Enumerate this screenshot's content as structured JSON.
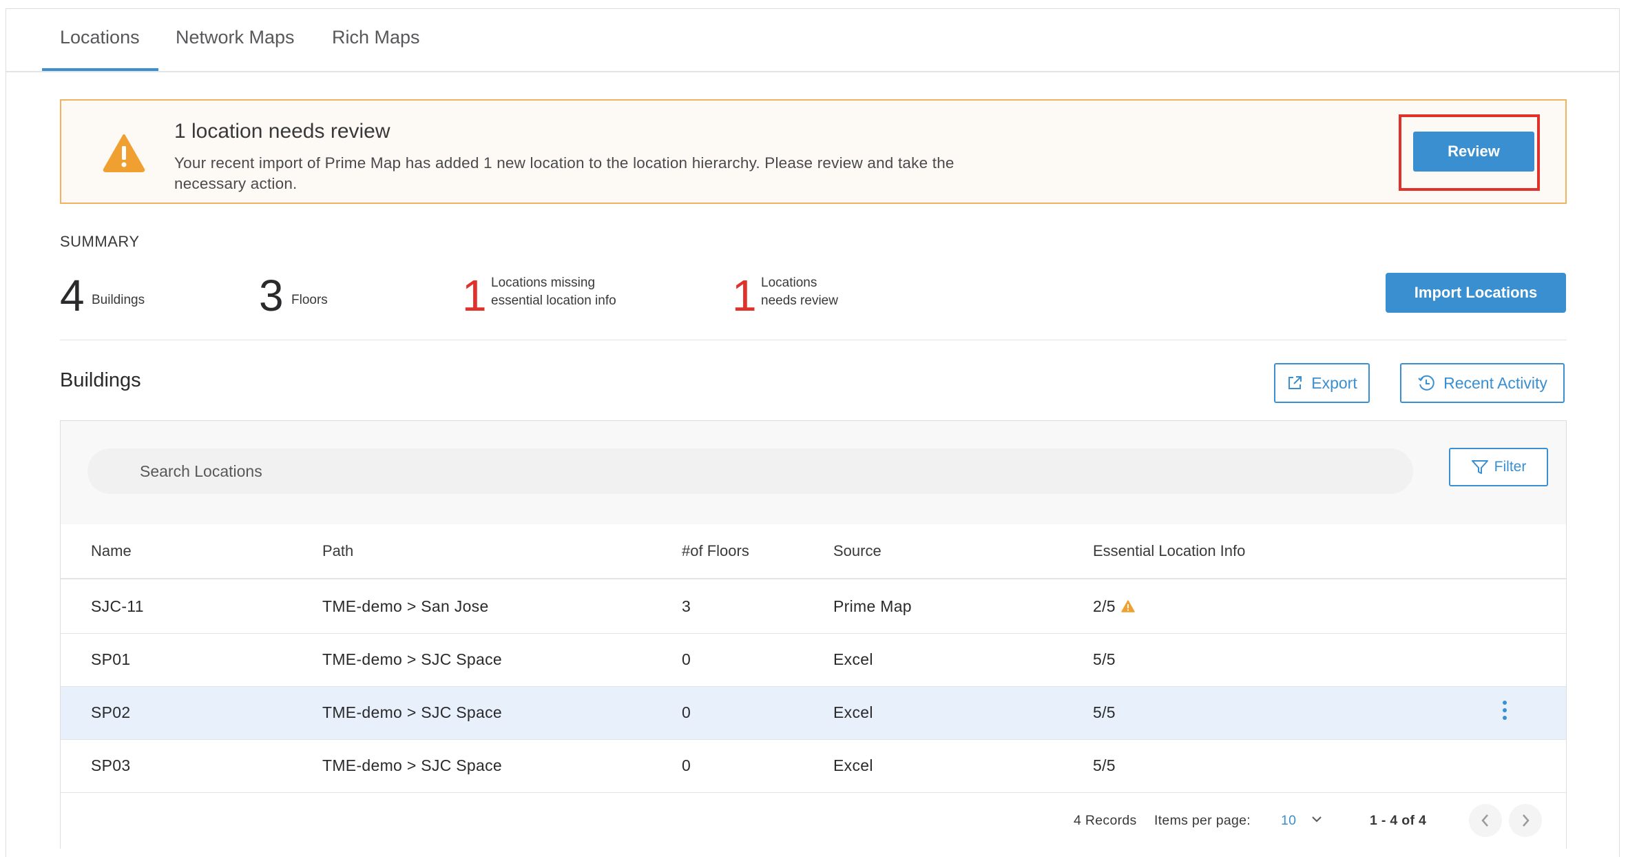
{
  "tabs": [
    {
      "label": "Locations",
      "active": true
    },
    {
      "label": "Network Maps",
      "active": false
    },
    {
      "label": "Rich Maps",
      "active": false
    }
  ],
  "alert": {
    "title": "1 location needs review",
    "message": "Your recent import of Prime Map has added 1 new location to the location hierarchy. Please review and take the necessary action.",
    "button": "Review",
    "icon": "warning-icon",
    "color": "#f0a030"
  },
  "summary": {
    "label": "SUMMARY",
    "buildings": {
      "count": "4",
      "label": "Buildings"
    },
    "floors": {
      "count": "3",
      "label": "Floors"
    },
    "missing": {
      "count": "1",
      "line1": "Locations missing",
      "line2": "essential location info"
    },
    "review": {
      "count": "1",
      "line1": "Locations",
      "line2": "needs review"
    },
    "import_button": "Import Locations"
  },
  "buildings": {
    "title": "Buildings",
    "export_label": "Export",
    "activity_label": "Recent Activity",
    "search_placeholder": "Search Locations",
    "filter_label": "Filter",
    "columns": [
      "Name",
      "Path",
      "#of Floors",
      "Source",
      "Essential Location Info"
    ],
    "rows": [
      {
        "name": "SJC-11",
        "path": "TME-demo > San Jose",
        "floors": "3",
        "source": "Prime Map",
        "info": "2/5",
        "warning": true
      },
      {
        "name": "SP01",
        "path": "TME-demo > SJC Space",
        "floors": "0",
        "source": "Excel",
        "info": "5/5",
        "warning": false
      },
      {
        "name": "SP02",
        "path": "TME-demo > SJC Space",
        "floors": "0",
        "source": "Excel",
        "info": "5/5",
        "warning": false
      },
      {
        "name": "SP03",
        "path": "TME-demo > SJC Space",
        "floors": "0",
        "source": "Excel",
        "info": "5/5",
        "warning": false
      }
    ]
  },
  "pagination": {
    "records": "4 Records",
    "items_label": "Items per page:",
    "items_value": "10",
    "range": "1 - 4 of 4"
  },
  "colors": {
    "accent": "#3a8fd0",
    "alert_red": "#e0312a",
    "warning": "#f0a030",
    "selected_row": "#e8f1fb"
  }
}
